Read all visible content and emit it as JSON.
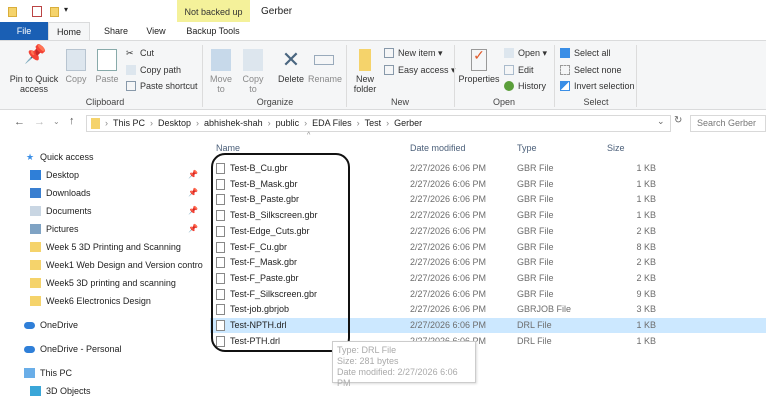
{
  "window": {
    "title": "Gerber",
    "context_tab_header": "Not backed up"
  },
  "tabs": [
    {
      "label": "File"
    },
    {
      "label": "Home"
    },
    {
      "label": "Share"
    },
    {
      "label": "View"
    },
    {
      "label": "Backup Tools"
    }
  ],
  "ribbon": {
    "clipboard": {
      "label": "Clipboard",
      "pin": "Pin to Quick access",
      "copy": "Copy",
      "paste": "Paste",
      "cut": "Cut",
      "copy_path": "Copy path",
      "paste_shortcut": "Paste shortcut"
    },
    "organize": {
      "label": "Organize",
      "move_to": "Move to",
      "copy_to": "Copy to",
      "delete": "Delete",
      "rename": "Rename"
    },
    "new": {
      "label": "New",
      "new_folder": "New folder",
      "new_item": "New item ▾",
      "easy_access": "Easy access ▾"
    },
    "open": {
      "label": "Open",
      "properties": "Properties",
      "open": "Open ▾",
      "edit": "Edit",
      "history": "History"
    },
    "select": {
      "label": "Select",
      "select_all": "Select all",
      "select_none": "Select none",
      "invert": "Invert selection"
    }
  },
  "address": {
    "path": [
      "This PC",
      "Desktop",
      "abhishek-shah",
      "public",
      "EDA Files",
      "Test",
      "Gerber"
    ],
    "search_placeholder": "Search Gerber"
  },
  "sidebar": {
    "quick_access": "Quick access",
    "items": [
      {
        "label": "Desktop",
        "pinned": true
      },
      {
        "label": "Downloads",
        "pinned": true
      },
      {
        "label": "Documents",
        "pinned": true
      },
      {
        "label": "Pictures",
        "pinned": true
      },
      {
        "label": "Week 5 3D Printing and Scanning"
      },
      {
        "label": "Week1 Web Design and Version contro"
      },
      {
        "label": "Week5 3D printing and scanning"
      },
      {
        "label": "Week6 Electronics Design"
      }
    ],
    "onedrive": "OneDrive",
    "onedrive_personal": "OneDrive - Personal",
    "this_pc": "This PC",
    "objects3d": "3D Objects"
  },
  "columns": {
    "name": "Name",
    "date": "Date modified",
    "type": "Type",
    "size": "Size"
  },
  "files": [
    {
      "name": "Test-B_Cu.gbr",
      "date": "2/27/2026 6:06 PM",
      "type": "GBR File",
      "size": "1 KB"
    },
    {
      "name": "Test-B_Mask.gbr",
      "date": "2/27/2026 6:06 PM",
      "type": "GBR File",
      "size": "1 KB"
    },
    {
      "name": "Test-B_Paste.gbr",
      "date": "2/27/2026 6:06 PM",
      "type": "GBR File",
      "size": "1 KB"
    },
    {
      "name": "Test-B_Silkscreen.gbr",
      "date": "2/27/2026 6:06 PM",
      "type": "GBR File",
      "size": "1 KB"
    },
    {
      "name": "Test-Edge_Cuts.gbr",
      "date": "2/27/2026 6:06 PM",
      "type": "GBR File",
      "size": "2 KB"
    },
    {
      "name": "Test-F_Cu.gbr",
      "date": "2/27/2026 6:06 PM",
      "type": "GBR File",
      "size": "8 KB"
    },
    {
      "name": "Test-F_Mask.gbr",
      "date": "2/27/2026 6:06 PM",
      "type": "GBR File",
      "size": "2 KB"
    },
    {
      "name": "Test-F_Paste.gbr",
      "date": "2/27/2026 6:06 PM",
      "type": "GBR File",
      "size": "2 KB"
    },
    {
      "name": "Test-F_Silkscreen.gbr",
      "date": "2/27/2026 6:06 PM",
      "type": "GBR File",
      "size": "9 KB"
    },
    {
      "name": "Test-job.gbrjob",
      "date": "2/27/2026 6:06 PM",
      "type": "GBRJOB File",
      "size": "3 KB"
    },
    {
      "name": "Test-NPTH.drl",
      "date": "2/27/2026 6:06 PM",
      "type": "DRL File",
      "size": "1 KB",
      "selected": true
    },
    {
      "name": "Test-PTH.drl",
      "date": "2/27/2026 6:06 PM",
      "type": "DRL File",
      "size": "1 KB"
    }
  ],
  "tooltip": {
    "type": "Type: DRL File",
    "size": "Size: 281 bytes",
    "date": "Date modified: 2/27/2026 6:06 PM"
  }
}
